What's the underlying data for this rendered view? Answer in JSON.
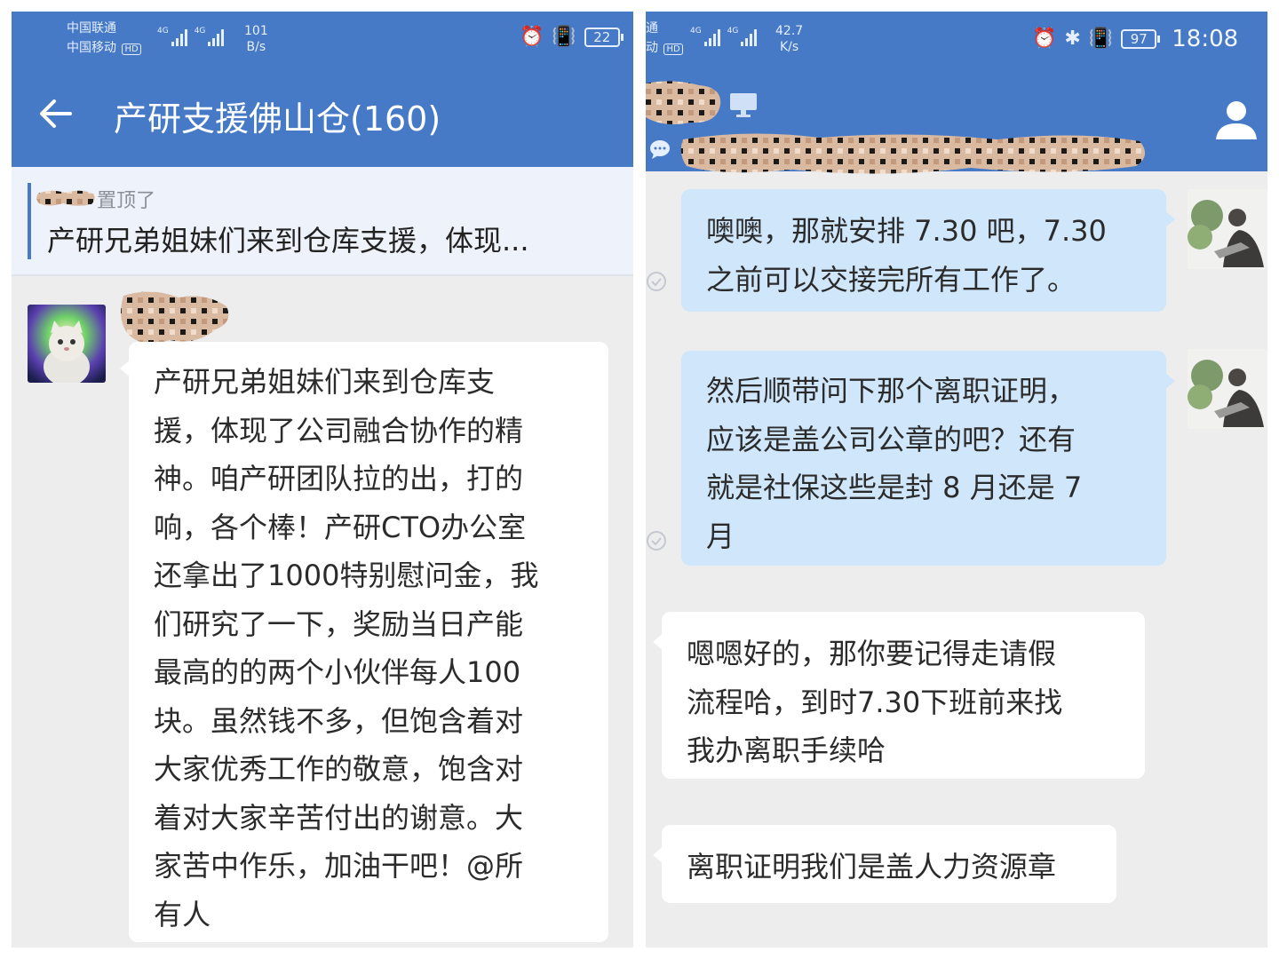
{
  "left": {
    "status": {
      "carrier1": "中国联通",
      "carrier2": "中国移动",
      "hd": "HD",
      "net": "4G",
      "speed_value": "101",
      "speed_unit": "B/s",
      "battery": "22"
    },
    "title": "产研支援佛山仓(160)",
    "pinned": {
      "note": "置顶了",
      "text": "产研兄弟姐妹们来到仓库支援，体现..."
    },
    "message": "产研兄弟姐妹们来到仓库支\n援，体现了公司融合协作的精\n神。咱产研团队拉的出，打的\n响，各个棒！产研CTO办公室\n还拿出了1000特别慰问金，我\n们研究了一下，奖励当日产能\n最高的的两个小伙伴每人100\n块。虽然钱不多，但饱含着对\n大家优秀工作的敬意，饱含对\n着对大家辛苦付出的谢意。大\n家苦中作乐，加油干吧！@所\n有人"
  },
  "right": {
    "status": {
      "carrier_fragment": "通",
      "carrier_fragment2": "动",
      "hd": "HD",
      "net": "4G",
      "speed_value": "42.7",
      "speed_unit": "K/s",
      "battery": "97",
      "time": "18:08"
    },
    "messages": [
      {
        "side": "sent",
        "text": "噢噢，那就安排 7.30 吧，7.30\n之前可以交接完所有工作了。"
      },
      {
        "side": "sent",
        "text": "然后顺带问下那个离职证明，\n应该是盖公司公章的吧？还有\n就是社保这些是封 8 月还是 7\n月"
      },
      {
        "side": "received",
        "text": "嗯嗯好的，那你要记得走请假\n流程哈，到时7.30下班前来找\n我办离职手续哈"
      },
      {
        "side": "received",
        "text": "离职证明我们是盖人力资源章"
      }
    ]
  },
  "colors": {
    "header_blue": "#4679c6",
    "chat_bg": "#ededed",
    "sent_bubble": "#cfe6fb",
    "received_bubble": "#ffffff"
  },
  "icons": {
    "back": "back-arrow-icon",
    "alarm": "alarm-icon",
    "vibrate": "vibrate-icon",
    "bluetooth": "bluetooth-icon",
    "monitor": "monitor-icon",
    "person": "person-icon",
    "check": "read-check-icon"
  }
}
